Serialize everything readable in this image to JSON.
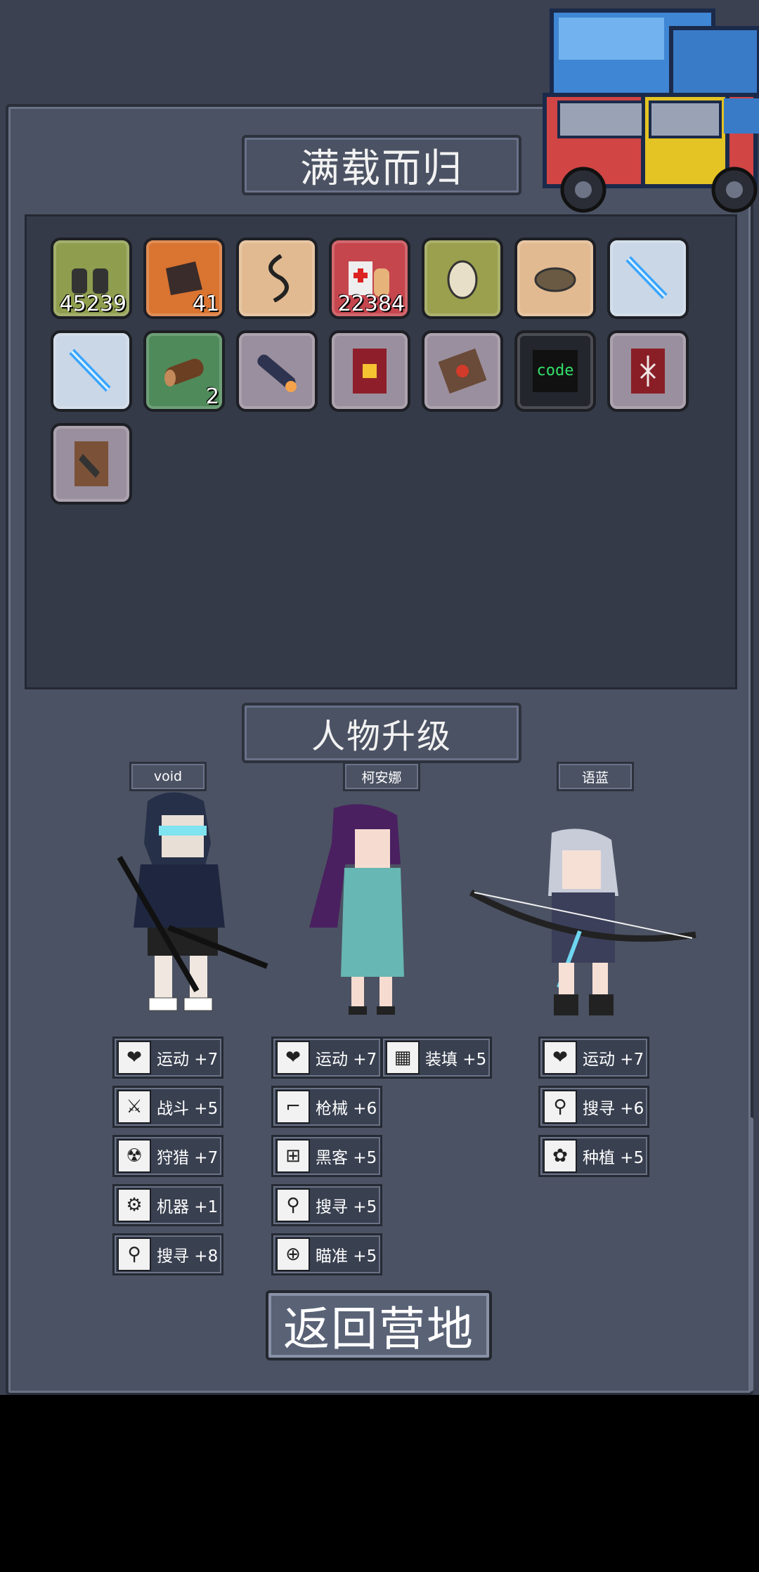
{
  "loot": {
    "title": "满载而归",
    "items": [
      {
        "icon": "gloves-icon",
        "bg": "green",
        "qty": "45239"
      },
      {
        "icon": "leather-scraps-icon",
        "bg": "orange",
        "qty": "41"
      },
      {
        "icon": "rope-icon",
        "bg": "tan",
        "qty": ""
      },
      {
        "icon": "medkit-icon",
        "bg": "red",
        "qty": "22384"
      },
      {
        "icon": "egg-icon",
        "bg": "olive",
        "qty": ""
      },
      {
        "icon": "bread-icon",
        "bg": "tan",
        "qty": ""
      },
      {
        "icon": "ice-sword-icon",
        "bg": "ice",
        "qty": ""
      },
      {
        "icon": "ice-sword-icon",
        "bg": "ice",
        "qty": ""
      },
      {
        "icon": "log-icon",
        "bg": "forest",
        "qty": "2"
      },
      {
        "icon": "flashlight-icon",
        "bg": "gray",
        "qty": ""
      },
      {
        "icon": "fitness-book-icon",
        "bg": "gray",
        "qty": ""
      },
      {
        "icon": "cooking-book-icon",
        "bg": "gray",
        "qty": ""
      },
      {
        "icon": "code-book-icon",
        "bg": "dark",
        "qty": "",
        "label": "code"
      },
      {
        "icon": "rune-book-icon",
        "bg": "gray",
        "qty": ""
      },
      {
        "icon": "gun-manual-icon",
        "bg": "gray",
        "qty": ""
      }
    ]
  },
  "upgrade": {
    "title": "人物升级",
    "characters": [
      {
        "name": "void",
        "skills": [
          {
            "icon": "heart-icon",
            "text": "运动 +7"
          },
          {
            "icon": "sword-icon",
            "text": "战斗 +5"
          },
          {
            "icon": "hazard-icon",
            "text": "狩猎 +7"
          },
          {
            "icon": "gear-icon",
            "text": "机器 +1"
          },
          {
            "icon": "magnifier-icon",
            "text": "搜寻 +8"
          }
        ]
      },
      {
        "name": "柯安娜",
        "skills": [
          {
            "icon": "heart-icon",
            "text": "运动 +7"
          },
          {
            "icon": "ammo-icon",
            "text": "装填 +5"
          },
          {
            "icon": "gun-icon",
            "text": "枪械 +6"
          },
          {
            "icon": "circuit-icon",
            "text": "黑客 +5"
          },
          {
            "icon": "magnifier-icon",
            "text": "搜寻 +5"
          },
          {
            "icon": "crosshair-icon",
            "text": "瞄准 +5"
          }
        ]
      },
      {
        "name": "语蓝",
        "skills": [
          {
            "icon": "heart-icon",
            "text": "运动 +7"
          },
          {
            "icon": "magnifier-icon",
            "text": "搜寻 +6"
          },
          {
            "icon": "plant-icon",
            "text": "种植 +5"
          }
        ]
      }
    ]
  },
  "return_button": "返回营地",
  "colors": {
    "panel": "#4b5263",
    "inventory_bg": "#343a47",
    "background": "#3b4150"
  }
}
